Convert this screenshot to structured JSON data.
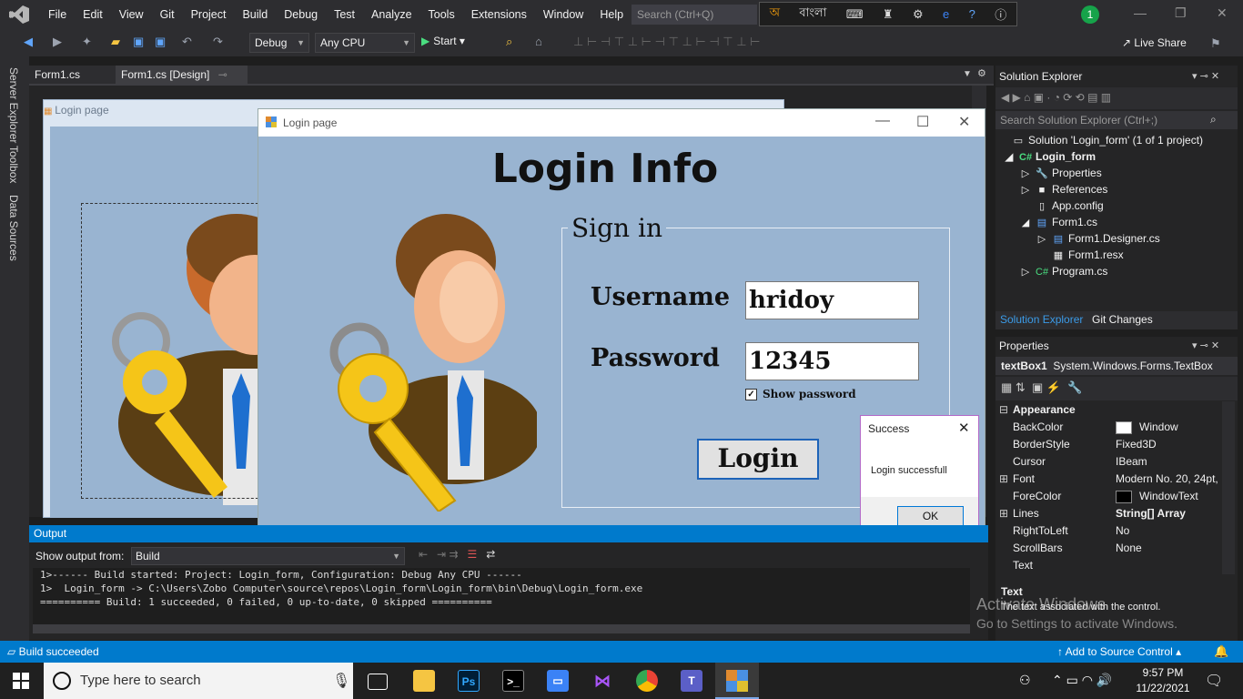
{
  "menubar": {
    "items": [
      "File",
      "Edit",
      "View",
      "Git",
      "Project",
      "Build",
      "Debug",
      "Test",
      "Analyze",
      "Tools",
      "Extensions",
      "Window",
      "Help"
    ],
    "search_placeholder": "Search (Ctrl+Q)",
    "lang_label": "বাংলা",
    "notification_count": "1"
  },
  "toolbar": {
    "config": "Debug",
    "platform": "Any CPU",
    "start_label": "Start",
    "live_share_label": "Live Share"
  },
  "side_tabs": [
    "Server Explorer",
    "Toolbox",
    "Data Sources"
  ],
  "doc_tabs": {
    "tab1": "Form1.cs",
    "tab2": "Form1.cs [Design]"
  },
  "designer": {
    "form_title": "Login page"
  },
  "login_window": {
    "title": "Login page",
    "heading": "Login Info",
    "group_label": "Sign in",
    "username_label": "Username",
    "username_value": "hridoy",
    "password_label": "Password",
    "password_value": "12345",
    "show_password_label": "Show password",
    "login_button": "Login"
  },
  "message_box": {
    "title": "Success",
    "text": "Login successfull",
    "ok_label": "OK"
  },
  "output": {
    "title": "Output",
    "show_from_label": "Show output from:",
    "source": "Build",
    "line1": "1>------ Build started: Project: Login_form, Configuration: Debug Any CPU ------",
    "line2": "1>  Login_form -> C:\\Users\\Zobo Computer\\source\\repos\\Login_form\\Login_form\\bin\\Debug\\Login_form.exe",
    "line3": "========== Build: 1 succeeded, 0 failed, 0 up-to-date, 0 skipped =========="
  },
  "solution_explorer": {
    "title": "Solution Explorer",
    "search_placeholder": "Search Solution Explorer (Ctrl+;)",
    "solution": "Solution 'Login_form' (1 of 1 project)",
    "project": "Login_form",
    "items": [
      "Properties",
      "References",
      "App.config",
      "Form1.cs",
      "Form1.Designer.cs",
      "Form1.resx",
      "Program.cs"
    ],
    "tab_active": "Solution Explorer",
    "tab_other": "Git Changes"
  },
  "properties": {
    "title": "Properties",
    "object_name": "textBox1",
    "object_type": "System.Windows.Forms.TextBox",
    "category": "Appearance",
    "rows": [
      {
        "name": "BackColor",
        "value": "Window"
      },
      {
        "name": "BorderStyle",
        "value": "Fixed3D"
      },
      {
        "name": "Cursor",
        "value": "IBeam"
      },
      {
        "name": "Font",
        "value": "Modern No. 20, 24pt,"
      },
      {
        "name": "ForeColor",
        "value": "WindowText"
      },
      {
        "name": "Lines",
        "value": "String[] Array"
      },
      {
        "name": "RightToLeft",
        "value": "No"
      },
      {
        "name": "ScrollBars",
        "value": "None"
      },
      {
        "name": "Text",
        "value": ""
      }
    ],
    "desc_title": "Text",
    "desc_text": "The text associated with the control.",
    "watermark1": "Activate Windows",
    "watermark2": "Go to Settings to activate Windows."
  },
  "status": {
    "left": "Build succeeded",
    "right": "Add to Source Control"
  },
  "taskbar": {
    "search_placeholder": "Type here to search",
    "time": "9:57 PM",
    "date": "11/22/2021"
  }
}
